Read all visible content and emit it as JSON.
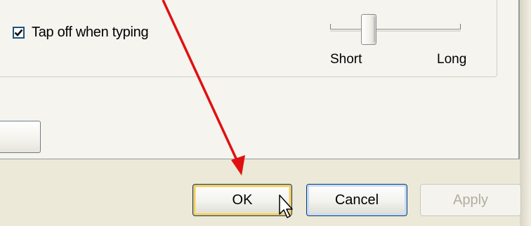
{
  "settings": {
    "tap_off_label": "Tap off when typing",
    "tap_off_checked": true,
    "slider": {
      "min_label": "Short",
      "max_label": "Long",
      "position_fraction": 0.27
    }
  },
  "dialog_buttons": {
    "ok_label": "OK",
    "cancel_label": "Cancel",
    "apply_label": "Apply",
    "apply_enabled": false,
    "focused": "OK"
  },
  "colors": {
    "annotation_arrow": "#e01010",
    "dialog_background": "#ece9d8"
  },
  "icons": {
    "cursor": "mouse-pointer-icon",
    "checkmark": "checkmark-icon"
  }
}
